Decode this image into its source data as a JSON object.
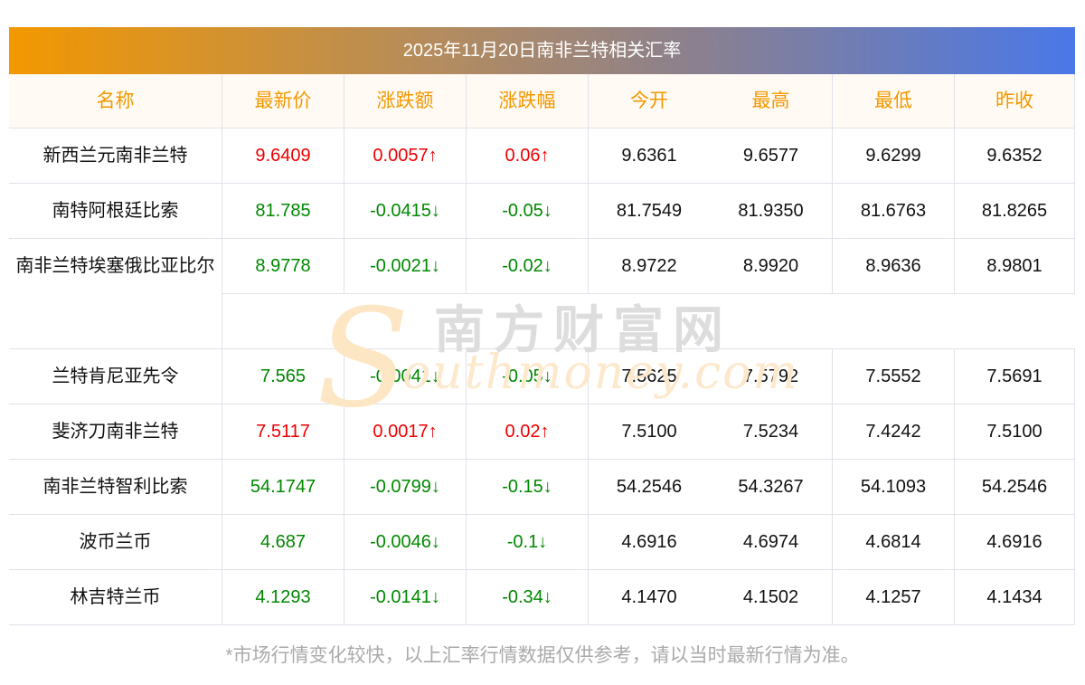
{
  "title": "2025年11月20日南非兰特相关汇率",
  "headers": [
    "名称",
    "最新价",
    "涨跌额",
    "涨跌幅",
    "今开",
    "最高",
    "最低",
    "昨收"
  ],
  "rows": [
    {
      "name": "新西兰元南非兰特",
      "dir": "up",
      "values": [
        "9.6409",
        "0.0057↑",
        "0.06↑",
        "9.6361",
        "9.6577",
        "9.6299",
        "9.6352"
      ]
    },
    {
      "name": "南特阿根廷比索",
      "dir": "down",
      "values": [
        "81.785",
        "-0.0415↓",
        "-0.05↓",
        "81.7549",
        "81.9350",
        "81.6763",
        "81.8265"
      ]
    },
    {
      "name": "南非兰特埃塞俄比亚比尔",
      "dir": "down",
      "values": [
        "8.9778",
        "-0.0021↓",
        "-0.02↓",
        "8.9722",
        "8.9920",
        "8.9636",
        "8.9801"
      ]
    },
    {
      "name": "兰特肯尼亚先令",
      "dir": "down",
      "values": [
        "7.565",
        "-0.0041↓",
        "-0.05↓",
        "7.5625",
        "7.5792",
        "7.5552",
        "7.5691"
      ]
    },
    {
      "name": "斐济刀南非兰特",
      "dir": "up",
      "values": [
        "7.5117",
        "0.0017↑",
        "0.02↑",
        "7.5100",
        "7.5234",
        "7.4242",
        "7.5100"
      ]
    },
    {
      "name": "南非兰特智利比索",
      "dir": "down",
      "values": [
        "54.1747",
        "-0.0799↓",
        "-0.15↓",
        "54.2546",
        "54.3267",
        "54.1093",
        "54.2546"
      ]
    },
    {
      "name": "波币兰币",
      "dir": "down",
      "values": [
        "4.687",
        "-0.0046↓",
        "-0.1↓",
        "4.6916",
        "4.6974",
        "4.6814",
        "4.6916"
      ]
    },
    {
      "name": "林吉特兰币",
      "dir": "down",
      "values": [
        "4.1293",
        "-0.0141↓",
        "-0.34↓",
        "4.1470",
        "4.1502",
        "4.1257",
        "4.1434"
      ]
    }
  ],
  "watermark": {
    "cn": "南方财富网",
    "en": "outhmoney.com",
    "s": "S"
  },
  "footer": "*市场行情变化较快，以上汇率行情数据仅供参考，请以当时最新行情为准。",
  "colors": {
    "up": "#ee0000",
    "down": "#008800",
    "header_text": "#f39800"
  }
}
